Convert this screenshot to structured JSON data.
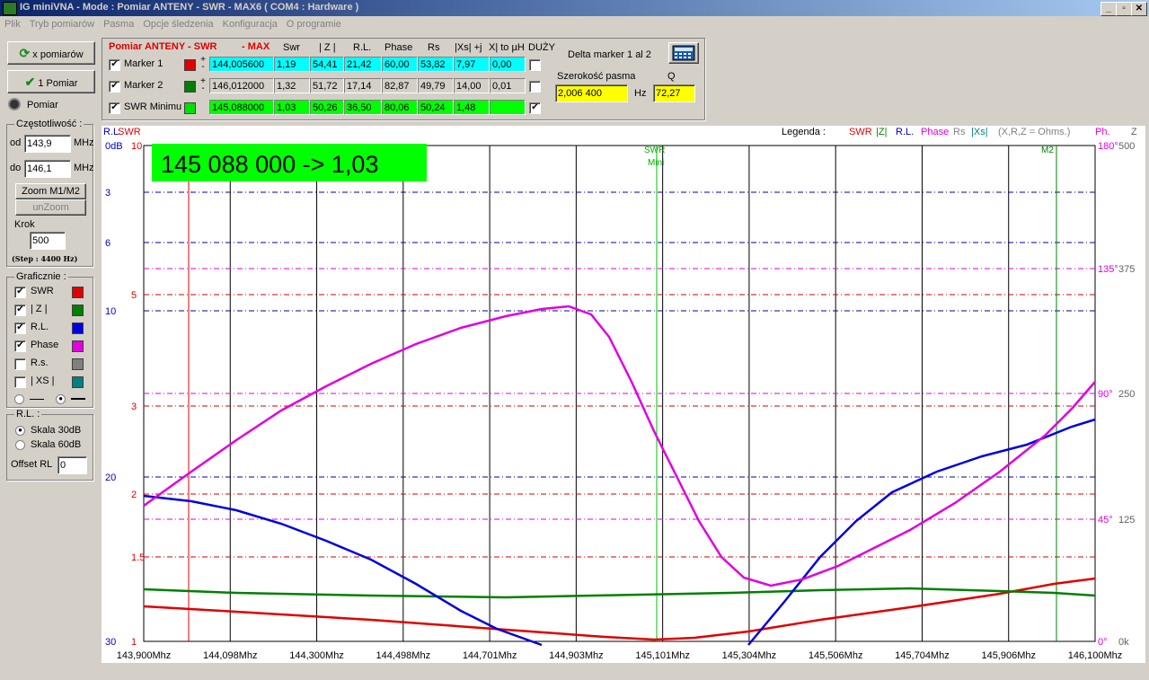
{
  "window": {
    "title": "IG miniVNA - Mode : Pomiar ANTENY - SWR     - MAX6  ( COM4 : Hardware )"
  },
  "menu": [
    "Plik",
    "Tryb pomiarów",
    "Pasma",
    "Opcje śledzenia",
    "Konfiguracja",
    "O programie"
  ],
  "left": {
    "x_pomiarow": "x pomiarów",
    "one_pomiar": "1 Pomiar",
    "pomiar": "Pomiar",
    "freq_group": "Częstotliwość :",
    "od_label": "od",
    "od_value": "143,9",
    "od_unit": "MHz",
    "do_label": "do",
    "do_value": "146,1",
    "do_unit": "MHz",
    "zoom": "Zoom M1/M2",
    "unzoom": "unZoom",
    "krok_label": "Krok",
    "krok_value": "500",
    "step_note": "(Step : 4400 Hz)",
    "graph_group": "Graficznie :",
    "graph_items": [
      {
        "label": "SWR",
        "checked": true,
        "color": "#e00000"
      },
      {
        "label": "| Z |",
        "checked": true,
        "color": "#008000"
      },
      {
        "label": "R.L.",
        "checked": true,
        "color": "#0000e0"
      },
      {
        "label": "Phase",
        "checked": true,
        "color": "#e000e0"
      },
      {
        "label": "R.s.",
        "checked": false,
        "color": "#808080"
      },
      {
        "label": "| XS |",
        "checked": false,
        "color": "#008080"
      }
    ],
    "rl_group": "R.L. :",
    "skala30": "Skala 30dB",
    "skala60": "Skala 60dB",
    "offset_label": "Offset RL",
    "offset_value": "0"
  },
  "top": {
    "title": "Pomiar ANTENY - SWR",
    "max": "- MAX",
    "headers": [
      "Swr",
      "| Z |",
      "R.L.",
      "Phase",
      "Rs",
      "|Xs| +j",
      "X| to µH",
      "DUŻY"
    ],
    "rows": [
      {
        "label": "Marker 1",
        "checked": true,
        "swatch": "#e00000",
        "bg": "#00ffff",
        "freq": "144,005600",
        "vals": [
          "1,19",
          "54,41",
          "21,42",
          "60,00",
          "53,82",
          "7,97",
          "0,00"
        ],
        "duzy": false
      },
      {
        "label": "Marker 2",
        "checked": true,
        "swatch": "#008000",
        "bg": "#d4d0c8",
        "freq": "146,012000",
        "vals": [
          "1,32",
          "51,72",
          "17,14",
          "82,87",
          "49,79",
          "14,00",
          "0,01"
        ],
        "duzy": false
      },
      {
        "label": "SWR Minimu",
        "checked": true,
        "swatch": "#00e000",
        "bg": "#00ff00",
        "freq": "145,088000",
        "vals": [
          "1,03",
          "50,26",
          "36,50",
          "80,06",
          "50,24",
          "1,48",
          ""
        ],
        "duzy": true
      }
    ],
    "delta": "Delta marker 1 al 2",
    "szer_label": "Szerokość pasma",
    "szer_value": "2,006 400",
    "hz": "Hz",
    "q_label": "Q",
    "q_value": "72,27"
  },
  "plot": {
    "left_axis_title_rl": "R.L.",
    "left_axis_title_swr": "SWR",
    "legend_label": "Legenda :",
    "legend": [
      {
        "text": "SWR",
        "color": "#e00000"
      },
      {
        "text": "|Z|",
        "color": "#008000"
      },
      {
        "text": "R.L.",
        "color": "#0000c0"
      },
      {
        "text": "Phase",
        "color": "#e000e0"
      },
      {
        "text": "Rs",
        "color": "#808080"
      },
      {
        "text": "|Xs|",
        "color": "#008080"
      },
      {
        "text": "(X,R,Z = Ohms.)",
        "color": "#808080"
      }
    ],
    "right_ph": "Ph.",
    "right_z": "Z",
    "readout": "145 088 000 -> 1,03",
    "marker_swr": "SWR",
    "marker_mini": "Mini",
    "marker_m2": "M2",
    "rl_ticks": [
      "0dB",
      "3",
      "6",
      "10",
      "20",
      "30"
    ],
    "swr_ticks": [
      "10",
      "5",
      "3",
      "2",
      "1.5",
      "1"
    ],
    "phase_ticks": [
      "180°",
      "135°",
      "90°",
      "45°",
      "0°"
    ],
    "z_ticks": [
      "500",
      "375",
      "250",
      "125",
      "0k"
    ],
    "x_ticks": [
      "143,900Mhz",
      "144,098Mhz",
      "144,300Mhz",
      "144,498Mhz",
      "144,701Mhz",
      "144,903Mhz",
      "145,101Mhz",
      "145,304Mhz",
      "145,506Mhz",
      "145,704Mhz",
      "145,906Mhz",
      "146,100Mhz"
    ]
  }
}
